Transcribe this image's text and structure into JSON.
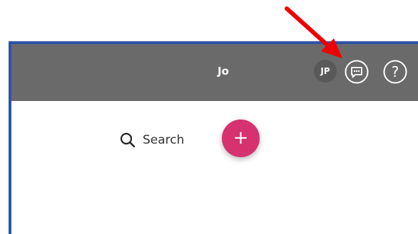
{
  "header": {
    "title": "Jo",
    "avatar_initials": "JP",
    "background_color": "#6b6a6a",
    "chat_icon": "chat-icon",
    "help_icon": "help-icon",
    "help_glyph": "?"
  },
  "main": {
    "search_label": "Search",
    "search_icon": "search-icon",
    "add_button_glyph": "+",
    "add_button_color": "#d6326f"
  },
  "annotation": {
    "arrow_icon": "red-arrow",
    "arrow_color": "#ee0000"
  },
  "frame": {
    "border_color": "#2d55a6"
  }
}
